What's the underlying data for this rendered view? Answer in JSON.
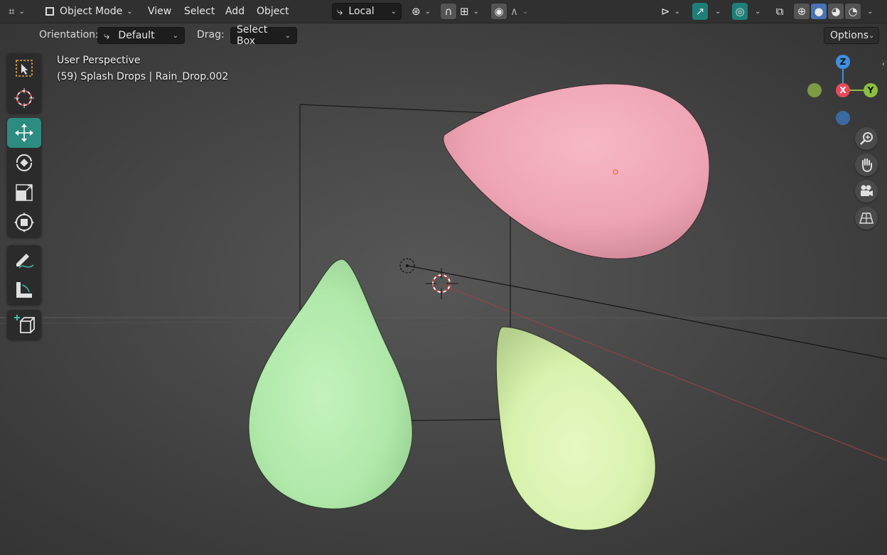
{
  "header": {
    "editor_type_icon": "3d-viewport-icon",
    "mode_label": "Object Mode",
    "menus": [
      "View",
      "Select",
      "Add",
      "Object"
    ],
    "transform_pivot_label": "Local",
    "shading_modes": [
      "wireframe",
      "solid",
      "material-preview",
      "rendered"
    ],
    "active_shading": "solid"
  },
  "tool_settings": {
    "orientation_label": "Orientation:",
    "orientation_value": "Default",
    "drag_label": "Drag:",
    "drag_value": "Select Box",
    "options_label": "Options"
  },
  "viewport": {
    "perspective_label": "User Perspective",
    "object_info": "(59) Splash Drops | Rain_Drop.002"
  },
  "tools": [
    {
      "name": "select-box-tool",
      "active": false
    },
    {
      "name": "cursor-tool",
      "active": false
    },
    {
      "name": "move-tool",
      "active": true
    },
    {
      "name": "rotate-tool",
      "active": false
    },
    {
      "name": "scale-tool",
      "active": false
    },
    {
      "name": "transform-tool",
      "active": false
    },
    {
      "name": "annotate-tool",
      "active": false
    },
    {
      "name": "measure-tool",
      "active": false
    },
    {
      "name": "add-cube-tool",
      "active": false
    }
  ],
  "gizmo": {
    "z_label": "Z",
    "y_label": "Y",
    "x_label": "X",
    "colors": {
      "x": "#e84a5a",
      "y": "#8cbf3f",
      "z": "#3f8ee0"
    }
  },
  "colors": {
    "accent_teal": "#2c8c80",
    "drop_pink": "#f0a3b4",
    "drop_green": "#b5eab0",
    "drop_lime": "#ddf5b0"
  }
}
